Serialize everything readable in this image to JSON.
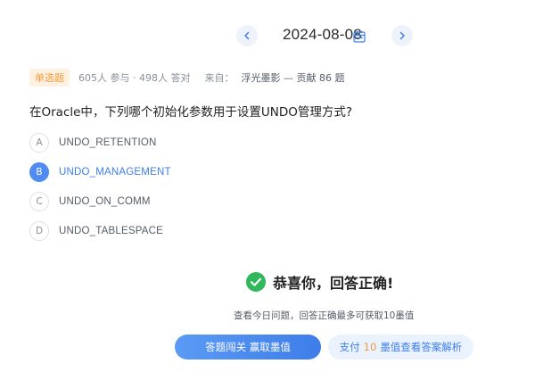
{
  "header": {
    "date": "2024-08-08",
    "prev_icon": "chevron-left-icon",
    "next_icon": "chevron-right-icon",
    "calendar_icon": "calendar-icon"
  },
  "meta": {
    "type_badge": "单选题",
    "stats": "605人 参与 · 498人 答对",
    "from_label": "来自：",
    "author": "浮光墨影 — 贡献 86 题"
  },
  "question": {
    "text": "在Oracle中，下列哪个初始化参数用于设置UNDO管理方式?"
  },
  "options": [
    {
      "letter": "A",
      "text": "UNDO_RETENTION",
      "selected": false
    },
    {
      "letter": "B",
      "text": "UNDO_MANAGEMENT",
      "selected": true
    },
    {
      "letter": "C",
      "text": "UNDO_ON_COMM",
      "selected": false
    },
    {
      "letter": "D",
      "text": "UNDO_TABLESPACE",
      "selected": false
    }
  ],
  "result": {
    "icon": "check-circle-icon",
    "text": "恭喜你，回答正确!",
    "hint": "查看今日问题，回答正确最多可获取10墨值"
  },
  "actions": {
    "primary_label": "答题闯关 赢取墨值",
    "secondary_prefix": "支付",
    "secondary_amount": "10",
    "secondary_suffix": "墨值查看答案解析"
  },
  "colors": {
    "accent": "#3e7de8",
    "badge_bg": "#fff1e0",
    "badge_text": "#f19a3e",
    "success": "#2fb75a"
  }
}
